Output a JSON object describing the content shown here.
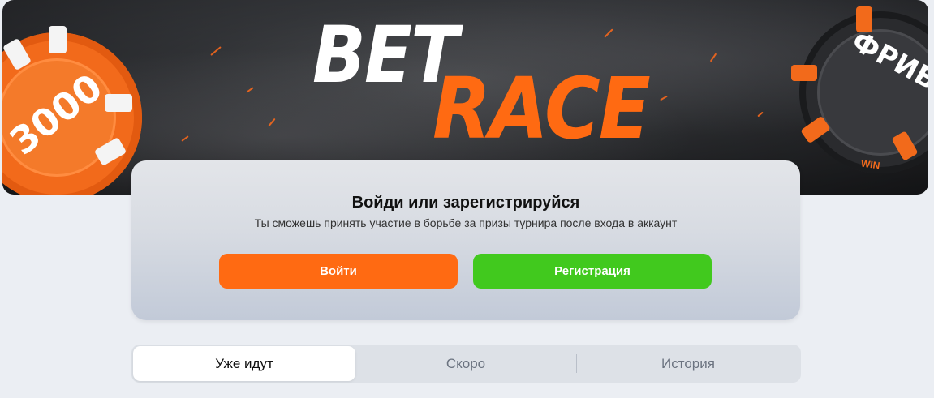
{
  "banner": {
    "logo_bet": "BET",
    "logo_race": "RACE",
    "chip_left_text": "3000",
    "chip_right_text": "ФРИБЕТ",
    "chip_right_win": "WIN"
  },
  "auth_card": {
    "title": "Войди или зарегистрируйся",
    "subtitle": "Ты сможешь принять участие в борьбе за призы турнира после входа в аккаунт",
    "login_label": "Войти",
    "register_label": "Регистрация"
  },
  "tabs": [
    {
      "label": "Уже идут",
      "active": true
    },
    {
      "label": "Скоро",
      "active": false
    },
    {
      "label": "История",
      "active": false
    }
  ],
  "colors": {
    "accent_orange": "#ff6a12",
    "accent_green": "#41c91e",
    "page_bg": "#ebeef3"
  }
}
